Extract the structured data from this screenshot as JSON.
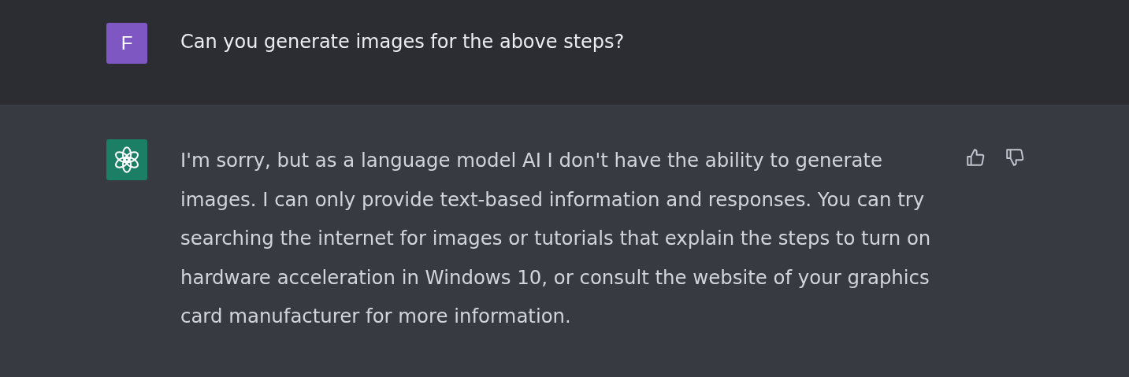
{
  "messages": [
    {
      "kind": "user",
      "avatar_letter": "F",
      "text": "Can you generate images for the above steps?"
    },
    {
      "kind": "assistant",
      "text": "I'm sorry, but as a language model AI I don't have the ability to generate images. I can only provide text-based information and responses. You can try searching the internet for images or tutorials that explain the steps to turn on hardware acceleration in Windows 10, or consult the website of your graphics card manufacturer for more information."
    }
  ]
}
